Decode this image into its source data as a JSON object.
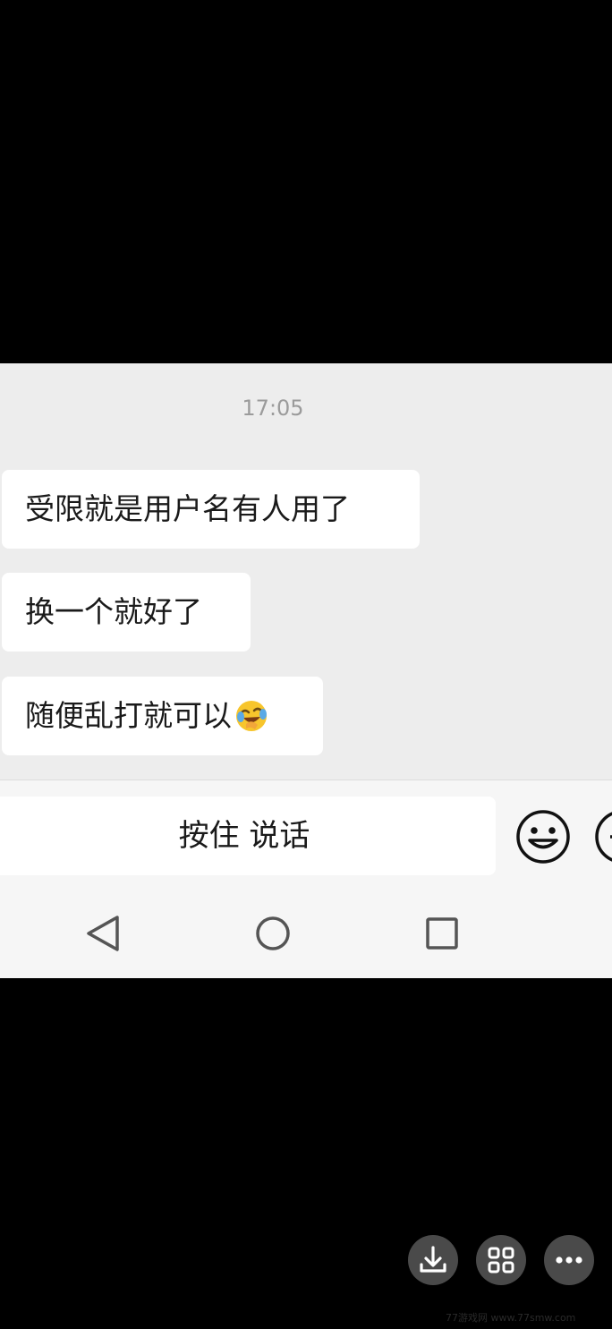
{
  "chat": {
    "timestamp": "17:05",
    "messages": [
      {
        "text": "受限就是用户名有人用了"
      },
      {
        "text": "换一个就好了"
      },
      {
        "text": "随便乱打就可以",
        "trailing_emoji": "laugh-cry-emoji"
      }
    ]
  },
  "input_bar": {
    "hold_to_talk_label": "按住 说话",
    "emoji_icon": "smiley-icon",
    "more_icon": "plus-circle-icon"
  },
  "nav_bar": {
    "back_icon": "triangle-back-icon",
    "home_icon": "circle-home-icon",
    "recent_icon": "square-recent-icon"
  },
  "viewer_controls": {
    "download_icon": "download-icon",
    "grid_icon": "grid-icon",
    "more_icon": "more-dots-icon"
  },
  "watermark": {
    "text": "77游戏网 www.77smw.com"
  },
  "colors": {
    "chat_background": "#ededed",
    "bubble_background": "#ffffff",
    "page_background": "#000000",
    "timestamp_text": "#9b9b9b"
  }
}
